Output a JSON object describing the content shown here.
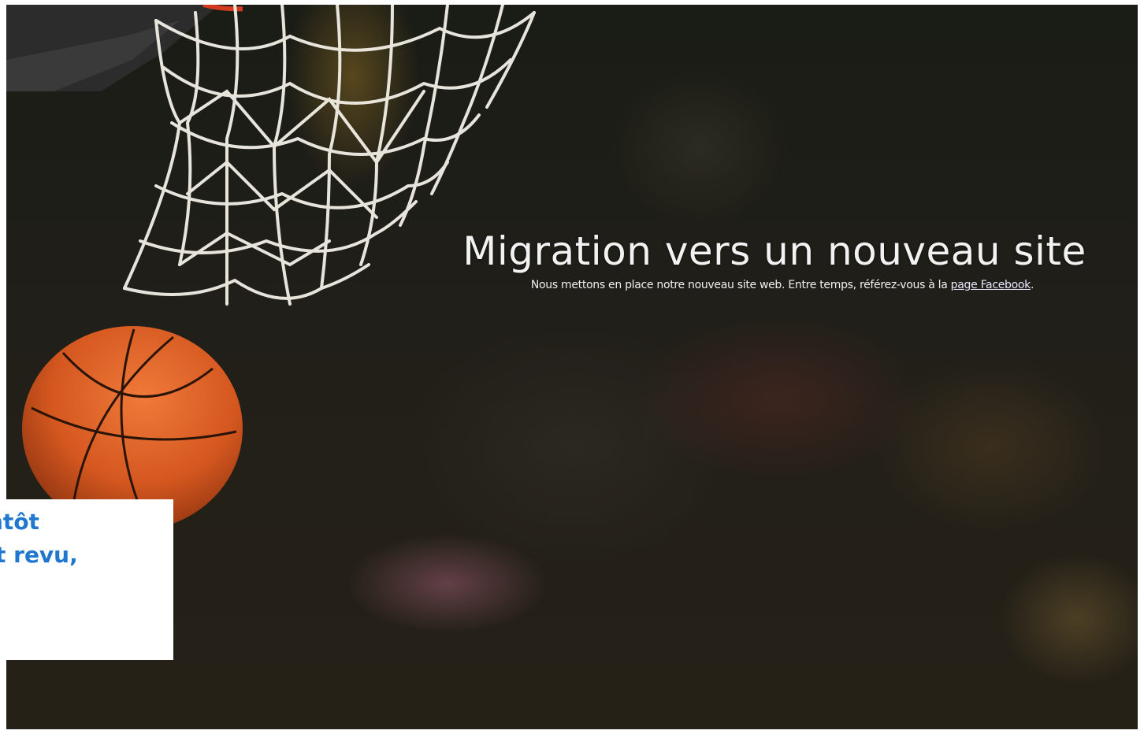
{
  "screen": {
    "headline": "Migration vers un nouveau site",
    "subline_text": "Nous mettons en place notre nouveau site web. Entre temps, référez-vous à la ",
    "facebook_link": "page Facebook",
    "subline_end": "."
  },
  "overlay": {
    "line1": "ntôt",
    "line2": "t revu,"
  },
  "colors": {
    "overlay_text": "#1f77d0",
    "ball": "#d4571f",
    "net": "#f2efe6"
  },
  "icons": {
    "net": "basketball-net-icon",
    "ball": "basketball-icon"
  }
}
